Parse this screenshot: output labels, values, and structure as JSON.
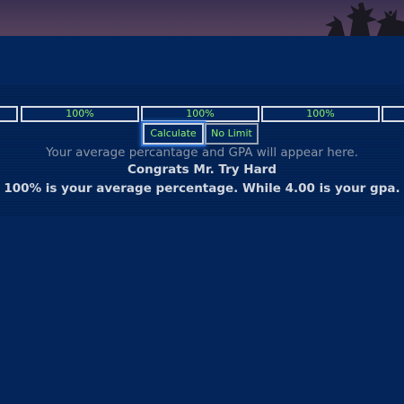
{
  "inputs": [
    "",
    "100%",
    "100%",
    "100%",
    ""
  ],
  "buttons": {
    "calculate_label": "Calculate",
    "no_limit_label": "No Limit"
  },
  "output": {
    "placeholder": "Your average percantage and GPA will appear here.",
    "congrats": "Congrats Mr. Try Hard",
    "result": "100% is your average percentage. While 4.00 is your gpa."
  },
  "colors": {
    "background": "#03255a",
    "input_text": "#8ff06f",
    "border": "#d8dde6",
    "focus_glow": "#2d6fd0"
  }
}
